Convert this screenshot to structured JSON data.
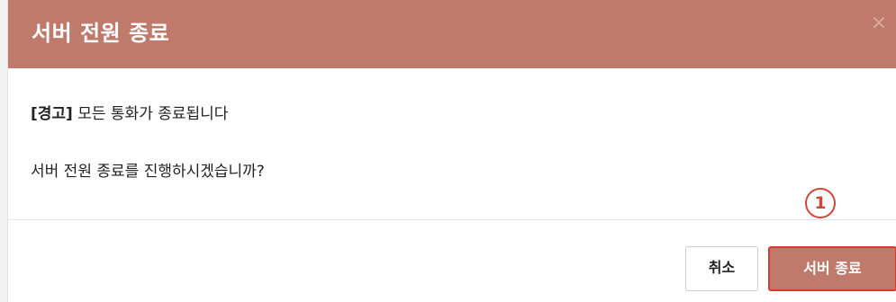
{
  "dialog": {
    "title": "서버 전원 종료",
    "close_icon": "×"
  },
  "body": {
    "warning_tag": "[경고]",
    "warning_text": " 모든 통화가 종료됩니다",
    "question": "서버 전원 종료를 진행하시겠습니까?"
  },
  "footer": {
    "cancel_label": "취소",
    "shutdown_label": "서버 종료",
    "step_marker": "1"
  },
  "colors": {
    "header_bg": "#c07a6c",
    "highlight": "#d93a2e"
  }
}
